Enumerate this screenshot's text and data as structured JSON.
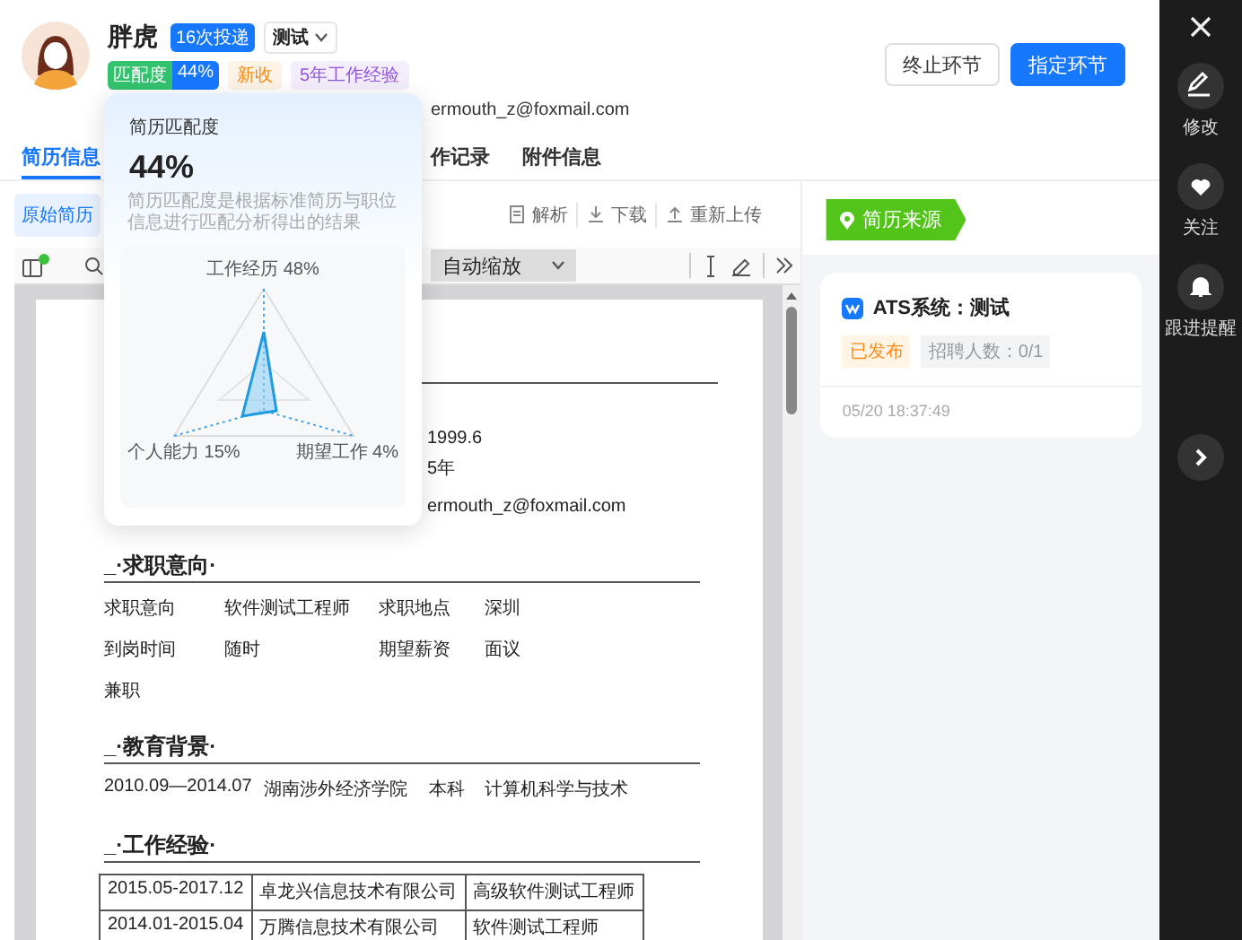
{
  "candidate": {
    "name": "胖虎",
    "applications": "16次投递",
    "job": "测试",
    "tags": [
      {
        "kind": "match",
        "label": "匹配度",
        "value": "44%"
      },
      {
        "kind": "plain",
        "label": "新收",
        "color": "#fa8c16"
      },
      {
        "kind": "plain",
        "label": "5年工作经验",
        "color": "#9254de"
      }
    ],
    "email": "ermouth_z@foxmail.com"
  },
  "actions": [
    {
      "label": "终止环节",
      "primary": false
    },
    {
      "label": "指定环节",
      "primary": true
    }
  ],
  "tabs": [
    {
      "label": "简历信息",
      "selected": true
    },
    {
      "label": "作记录",
      "selected": false
    },
    {
      "label": "附件信息",
      "selected": false
    }
  ],
  "resume_toolbar": {
    "view": {
      "label": "原始简历",
      "selected": true
    },
    "actions": [
      {
        "kind": "parse",
        "label": "解析"
      },
      {
        "kind": "download",
        "label": "下载"
      },
      {
        "kind": "upload",
        "label": "重新上传"
      }
    ]
  },
  "viewer": {
    "zoom": "自动缩放",
    "info_lines": [
      "1999.6",
      "5年",
      "ermouth_z@foxmail.com"
    ],
    "sections": [
      {
        "title": "_·求职意向·",
        "kind": "fields",
        "rows": [
          [
            "求职意向",
            "软件测试工程师",
            "求职地点",
            "深圳"
          ],
          [
            "到岗时间",
            "随时",
            "期望薪资",
            "面议"
          ],
          [
            "兼职"
          ]
        ]
      },
      {
        "title": "_·教育背景·",
        "kind": "line",
        "rows": [
          [
            "2010.09—2014.07",
            "湖南涉外经济学院",
            "本科",
            "计算机科学与技术"
          ]
        ]
      },
      {
        "title": "_·工作经验·",
        "kind": "table",
        "rows": [
          [
            "2015.05-2017.12",
            "卓龙兴信息技术有限公司",
            "高级软件测试工程师"
          ],
          [
            "2014.01-2015.04",
            "万腾信息技术有限公司",
            "软件测试工程师"
          ]
        ]
      }
    ]
  },
  "source": {
    "tag": "简历来源",
    "title": "ATS系统：测试",
    "status": "已发布",
    "count": "招聘人数：0/1",
    "time": "05/20 18:37:49"
  },
  "side_actions": [
    {
      "kind": "edit",
      "label": "修改"
    },
    {
      "kind": "follow",
      "label": "关注"
    },
    {
      "kind": "remind",
      "label": "跟进提醒"
    },
    {
      "kind": "next"
    }
  ],
  "popup": {
    "title": "简历匹配度",
    "score": "44%",
    "description": "简历匹配度是根据标准简历与职位信息进行匹配分析得出的结果",
    "axes": [
      {
        "label": "工作经历 48%"
      },
      {
        "label": "个人能力 15%"
      },
      {
        "label": "期望工作 4%"
      }
    ]
  }
}
